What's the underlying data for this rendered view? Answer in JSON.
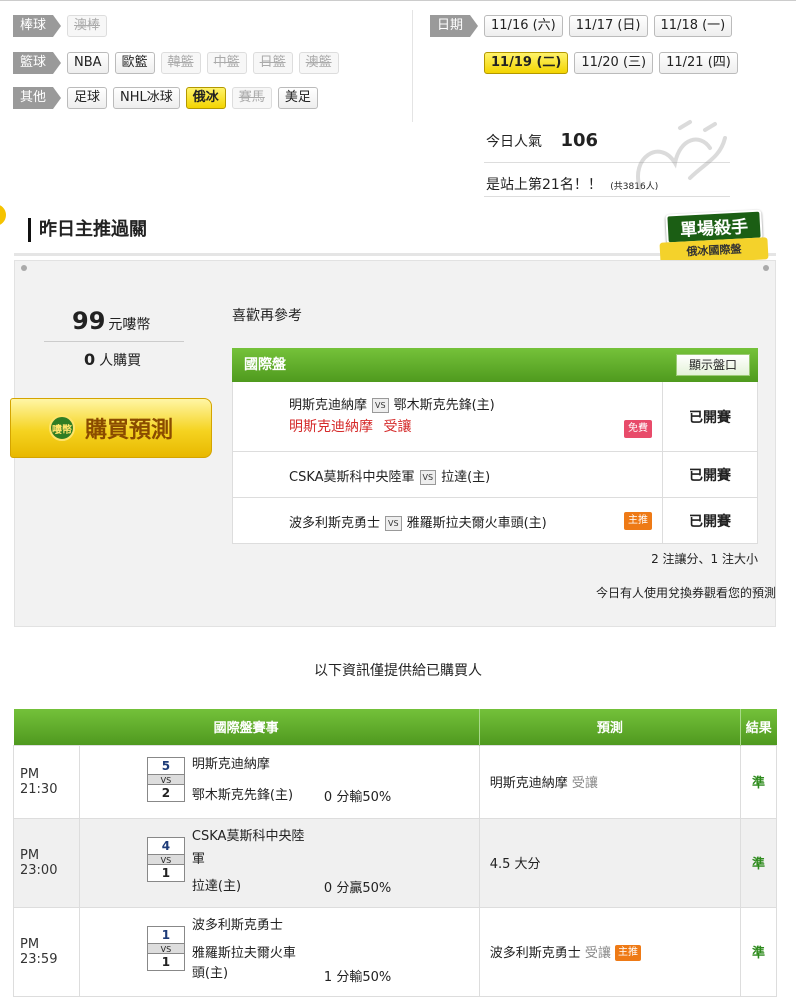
{
  "nav": {
    "baseball": {
      "tag": "棒球",
      "items": [
        {
          "label": "澳棒",
          "state": "disabled"
        }
      ]
    },
    "basketball": {
      "tag": "籃球",
      "items": [
        {
          "label": "NBA",
          "state": "normal"
        },
        {
          "label": "歐籃",
          "state": "normal"
        },
        {
          "label": "韓籃",
          "state": "disabled"
        },
        {
          "label": "中籃",
          "state": "disabled"
        },
        {
          "label": "日籃",
          "state": "disabled"
        },
        {
          "label": "澳籃",
          "state": "disabled"
        }
      ]
    },
    "other": {
      "tag": "其他",
      "items": [
        {
          "label": "足球",
          "state": "normal"
        },
        {
          "label": "NHL冰球",
          "state": "normal"
        },
        {
          "label": "俄冰",
          "state": "active"
        },
        {
          "label": "賽馬",
          "state": "disabled"
        },
        {
          "label": "美足",
          "state": "normal"
        }
      ]
    },
    "date": {
      "tag": "日期",
      "row1": [
        "11/16 (六)",
        "11/17 (日)",
        "11/18 (一)"
      ],
      "row2": [
        "11/19 (二)",
        "11/20 (三)",
        "11/21 (四)"
      ],
      "active": "11/19 (二)"
    }
  },
  "popularity": {
    "label": "今日人氣",
    "value": "106",
    "rank": "是站上第21名！！",
    "total": "(共3816人)"
  },
  "panel": {
    "title": "昨日主推過關",
    "badge_top": "單場殺手",
    "badge_bottom": "俄冰國際盤",
    "price_value": "99",
    "price_unit": "元嘍幣",
    "buyers_count": "0",
    "buyers_unit": "人購買",
    "buy_button": "購買預測",
    "coin_icon_text": "嘍幣",
    "ref_text": "喜歡再參考",
    "intl_header": "國際盤",
    "show_odds": "顯示盤口",
    "games": [
      {
        "home": "明斯克迪納摩",
        "vs": "VS",
        "away": "鄂木斯克先鋒(主)",
        "pick": "明斯克迪納摩",
        "pick_type": "受讓",
        "chip": "免費",
        "status": "已開賽"
      },
      {
        "home": "CSKA莫斯科中央陸軍",
        "vs": "VS",
        "away": "拉達(主)",
        "status": "已開賽"
      },
      {
        "home": "波多利斯克勇士",
        "vs": "VS",
        "away": "雅羅斯拉夫爾火車頭(主)",
        "chip": "主推",
        "status": "已開賽"
      }
    ],
    "summary": "2 注讓分、1 注大小",
    "voucher_note": "今日有人使用兌換券觀看您的預測"
  },
  "info_text": "以下資訊僅提供給已購買人",
  "results_table": {
    "headers": [
      "國際盤賽事",
      "預測",
      "結果"
    ],
    "rows": [
      {
        "time": "PM 21:30",
        "score_top": "5",
        "vs": "VS",
        "score_bottom": "2",
        "team1": "明斯克迪納摩",
        "team2": "鄂木斯克先鋒(主)",
        "handicap": "0 分輸50%",
        "pred": "明斯克迪納摩",
        "pred_type": "受讓",
        "result": "準"
      },
      {
        "time": "PM 23:00",
        "score_top": "4",
        "vs": "VS",
        "score_bottom": "1",
        "team1": "CSKA莫斯科中央陸",
        "team1b": "軍",
        "team2": "拉達(主)",
        "handicap": "0 分贏50%",
        "pred": "4.5 大分",
        "result": "準"
      },
      {
        "time": "PM 23:59",
        "score_top": "1",
        "vs": "VS",
        "score_bottom": "1",
        "team1": "波多利斯克勇士",
        "team2": "雅羅斯拉夫爾火車",
        "team2b": "頭(主)",
        "handicap": "1 分輸50%",
        "pred": "波多利斯克勇士",
        "pred_type": "受讓",
        "pred_chip": "主推",
        "result": "準"
      }
    ]
  },
  "colors": {
    "green": "#5aa82a",
    "yellow": "#f3d400",
    "red": "#d52b2b"
  }
}
